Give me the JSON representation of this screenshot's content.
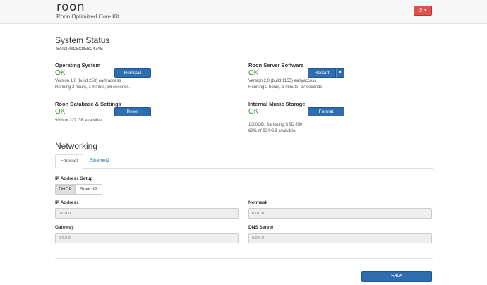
{
  "header": {
    "logo": "roon",
    "subtitle": "Roon Optimized Core Kit",
    "power_icon": "⏻",
    "caret": "▼"
  },
  "system_status": {
    "title": "System Status",
    "serial": "Serial #9C5C8EBC47AE",
    "os": {
      "name": "Operating System",
      "status": "OK",
      "line1": "Version 1.0 (build 253) earlyaccess",
      "line2": "Running 2 hours, 1 minute, 36 seconds.",
      "button": "Reinstall"
    },
    "server": {
      "name": "Roon Server Software",
      "status": "OK",
      "line1": "Version 2.0 (build 1155) earlyaccess",
      "line2": "Running 2 hours, 1 minute, 27 seconds.",
      "button": "Restart"
    },
    "database": {
      "name": "Roon Database & Settings",
      "status": "OK",
      "line1": "99% of 227 GB available.",
      "button": "Reset"
    },
    "storage": {
      "name": "Internal Music Storage",
      "status": "OK",
      "line1": "1000GB, Samsung SSD 850",
      "line2": "62% of 924 GB available.",
      "button": "Format"
    }
  },
  "networking": {
    "title": "Networking",
    "tabs": [
      "Ethernet",
      "Ethernet2"
    ],
    "ip_setup_label": "IP Address Setup",
    "modes": [
      "DHCP",
      "Static IP"
    ],
    "fields": {
      "ip_label": "IP Address",
      "ip_value": "0.0.0.0",
      "netmask_label": "Netmask",
      "netmask_value": "0.0.0.0",
      "gateway_label": "Gateway",
      "gateway_value": "0.0.0.0",
      "dns_label": "DNS Server",
      "dns_value": "0.0.0.0"
    },
    "save": "Save"
  },
  "colors": {
    "primary": "#2d6db0",
    "danger": "#d9534f",
    "ok": "#3c8d3c"
  }
}
